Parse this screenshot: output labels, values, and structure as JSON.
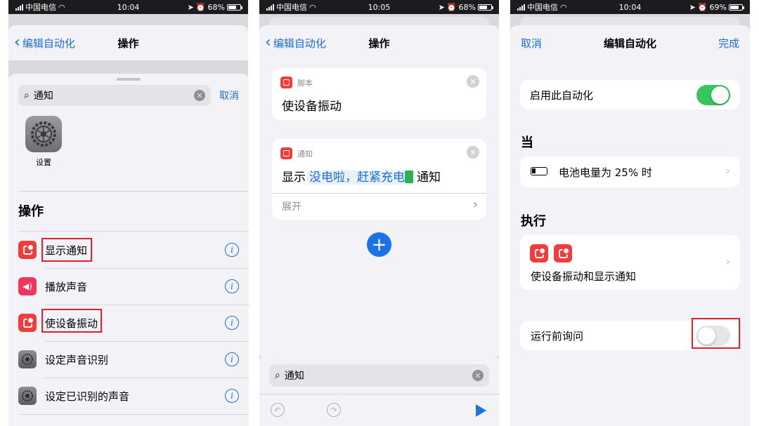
{
  "status_bars": [
    {
      "carrier": "中国电信",
      "time": "10:04",
      "battery": "68%",
      "battery_level": 0.68
    },
    {
      "carrier": "中国电信",
      "time": "10:05",
      "battery": "68%",
      "battery_level": 0.68
    },
    {
      "carrier": "中国电信",
      "time": "10:04",
      "battery": "69%",
      "battery_level": 0.69
    }
  ],
  "panel1": {
    "back_label": "编辑自动化",
    "title": "操作",
    "search_value": "通知",
    "cancel_label": "取消",
    "app_label": "设置",
    "section_title": "操作",
    "actions": [
      {
        "label": "显示通知",
        "icon": "notification-icon",
        "highlighted": true
      },
      {
        "label": "播放声音",
        "icon": "speaker-icon",
        "highlighted": false
      },
      {
        "label": "使设备振动",
        "icon": "notification-icon",
        "highlighted": true
      },
      {
        "label": "设定声音识别",
        "icon": "gear-icon",
        "highlighted": false
      },
      {
        "label": "设定已识别的声音",
        "icon": "gear-icon",
        "highlighted": false
      }
    ]
  },
  "panel2": {
    "back_label": "编辑自动化",
    "title": "操作",
    "card1": {
      "tag": "脚本",
      "title": "使设备振动"
    },
    "card2": {
      "tag": "通知",
      "prefix": "显示",
      "message": "没电啦，赶紧充电",
      "suffix": "通知",
      "expand": "展开"
    },
    "search_value": "通知"
  },
  "panel3": {
    "cancel_label": "取消",
    "title": "编辑自动化",
    "done_label": "完成",
    "enable_label": "启用此自动化",
    "enable_on": true,
    "when_title": "当",
    "trigger_label": "电池电量为 25% 时",
    "do_title": "执行",
    "do_label": "使设备振动和显示通知",
    "ask_label": "运行前询问",
    "ask_on": false
  },
  "colors": {
    "accent": "#1a6fd6",
    "toggle_on": "#34c759",
    "highlight": "#e0202b",
    "app_red": "#f23b3b"
  }
}
